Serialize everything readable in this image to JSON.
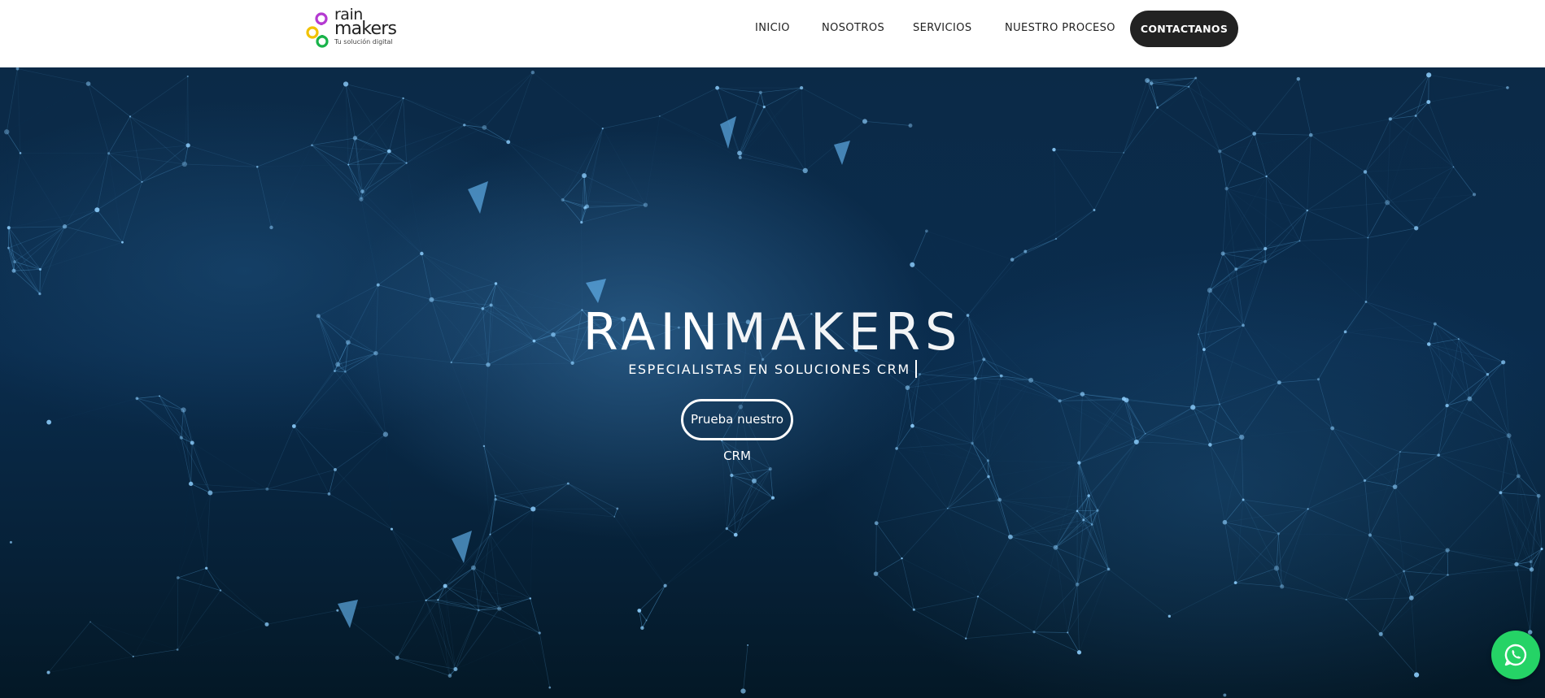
{
  "header": {
    "logo": {
      "word1": "rain",
      "word2": "makers",
      "tagline": "Tu solución digital",
      "colors": [
        "#b43ad1",
        "#f2c200",
        "#19b34a"
      ]
    },
    "nav": {
      "items": [
        "INICIO",
        "NOSOTROS",
        "SERVICIOS",
        "NUESTRO PROCESO"
      ],
      "cta_label": "CONTACTANOS",
      "cta_color": "#222222"
    }
  },
  "hero": {
    "title_part1": "RAIN",
    "title_part2": "MAKERS",
    "subtitle": "ESPECIALISTAS EN SOLUCIONES CRM",
    "button_label": "Prueba nuestro CRM",
    "background": "network-particles-blue"
  },
  "whatsapp": {
    "icon": "whatsapp-icon",
    "color": "#25d366"
  }
}
